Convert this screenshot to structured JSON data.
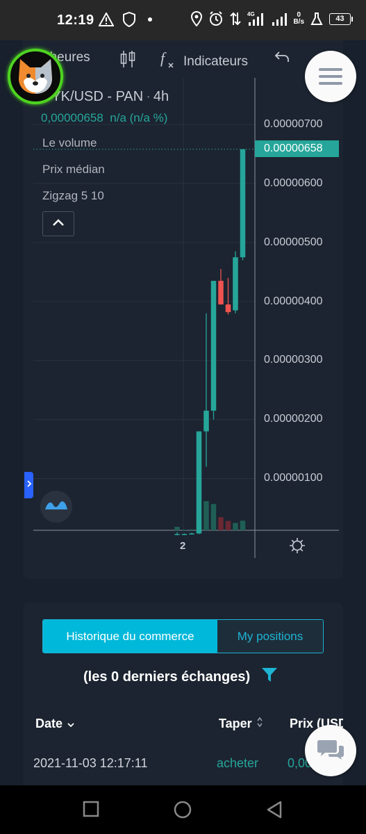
{
  "status_bar": {
    "time": "12:19",
    "net_speed_value": "0",
    "net_speed_unit": "B/s",
    "network_type": "4G",
    "battery": "43"
  },
  "toolbar": {
    "interval": "4heures",
    "indicators": "Indicateurs"
  },
  "chart": {
    "symbol": "BYK/USD - PAN",
    "separator": "·",
    "interval": "4h",
    "last_price": "0,00000658",
    "change": "n/a (n/a %)",
    "legend": [
      "Le volume",
      "Prix médian",
      "Zigzag 5 10"
    ],
    "current_price_tag": "0.00000658",
    "price_axis": [
      "0.00000700",
      "0.00000600",
      "0.00000500",
      "0.00000400",
      "0.00000300",
      "0.00000200",
      "0.00000100"
    ],
    "time_axis": [
      "2"
    ]
  },
  "chart_data": {
    "type": "candlestick",
    "ylim": [
      0,
      7.2e-06
    ],
    "candles": [
      {
        "open": 5e-08,
        "high": 9e-08,
        "low": 4e-08,
        "close": 6e-08,
        "direction": "up"
      },
      {
        "open": 6e-08,
        "high": 7e-08,
        "low": 5e-08,
        "close": 6e-08,
        "direction": "up"
      },
      {
        "open": 6e-08,
        "high": 8e-08,
        "low": 5e-08,
        "close": 7e-08,
        "direction": "up"
      },
      {
        "open": 7e-08,
        "high": 2e-07,
        "low": 6e-08,
        "close": 1.8e-06,
        "direction": "up"
      },
      {
        "open": 1.8e-06,
        "high": 3.8e-06,
        "low": 1.2e-06,
        "close": 2.15e-06,
        "direction": "up"
      },
      {
        "open": 2.15e-06,
        "high": 4.35e-06,
        "low": 2e-06,
        "close": 4.35e-06,
        "direction": "up"
      },
      {
        "open": 4.35e-06,
        "high": 4.55e-06,
        "low": 3.95e-06,
        "close": 3.95e-06,
        "direction": "down"
      },
      {
        "open": 3.95e-06,
        "high": 4.4e-06,
        "low": 3.78e-06,
        "close": 3.82e-06,
        "direction": "down"
      },
      {
        "open": 3.85e-06,
        "high": 4.85e-06,
        "low": 3.8e-06,
        "close": 4.75e-06,
        "direction": "up"
      },
      {
        "open": 4.75e-06,
        "high": 6.58e-06,
        "low": 4.7e-06,
        "close": 6.58e-06,
        "direction": "up"
      }
    ],
    "volumes": [
      0.12,
      0.02,
      0.03,
      0.42,
      1.0,
      0.9,
      0.45,
      0.32,
      0.25,
      0.33
    ],
    "colors": {
      "up": "#26a69a",
      "down": "#ef5350",
      "volume_up": "#1f5f55",
      "volume_down": "#6b2832"
    }
  },
  "trades": {
    "tab_history": "Historique du commerce",
    "tab_positions": "My positions",
    "count_text": "(les 0 derniers échanges)",
    "columns": {
      "date": "Date",
      "type": "Taper",
      "price": "Prix (USD"
    },
    "rows": [
      {
        "date": "2021-11-03 12:17:11",
        "type": "acheter",
        "price": "0,00"
      }
    ]
  },
  "colors": {
    "accent": "#00b8d9",
    "buy": "#26a69a",
    "panel": "#1c2431",
    "background": "#17202c"
  }
}
